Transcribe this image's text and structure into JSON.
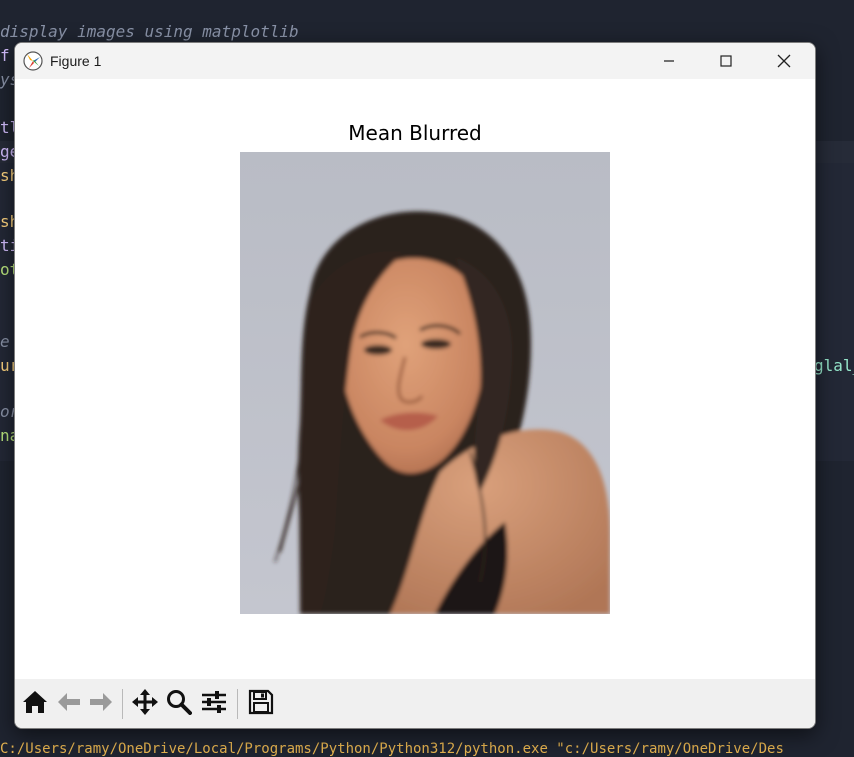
{
  "editor": {
    "comment_line": "display images using matplotlib",
    "left_fragments": [
      "f",
      "ys",
      "tl",
      "ge",
      "sh",
      "sh",
      "ti",
      "ot",
      "e",
      "ur",
      "or",
      "na"
    ],
    "right_fragment": "glal_",
    "terminal_text": "C:/Users/ramy/OneDrive/Local/Programs/Python/Python312/python.exe \"c:/Users/ramy/OneDrive/Des"
  },
  "window": {
    "title": "Figure 1",
    "controls": {
      "minimize_icon": "minimize-icon",
      "maximize_icon": "maximize-icon",
      "close_icon": "close-icon"
    }
  },
  "plot": {
    "title": "Mean Blurred",
    "image_subject": "portrait-photo"
  },
  "toolbar": {
    "buttons": [
      "home-icon",
      "back-arrow-icon",
      "forward-arrow-icon",
      "pan-icon",
      "zoom-icon",
      "configure-subplots-icon",
      "save-icon"
    ]
  },
  "colors": {
    "editor_bg": "#1f2430",
    "comment": "#8a93a8",
    "keyword": "#d4bfff",
    "string": "#bae67e",
    "function": "#ffd580",
    "attr": "#95e6cb"
  }
}
